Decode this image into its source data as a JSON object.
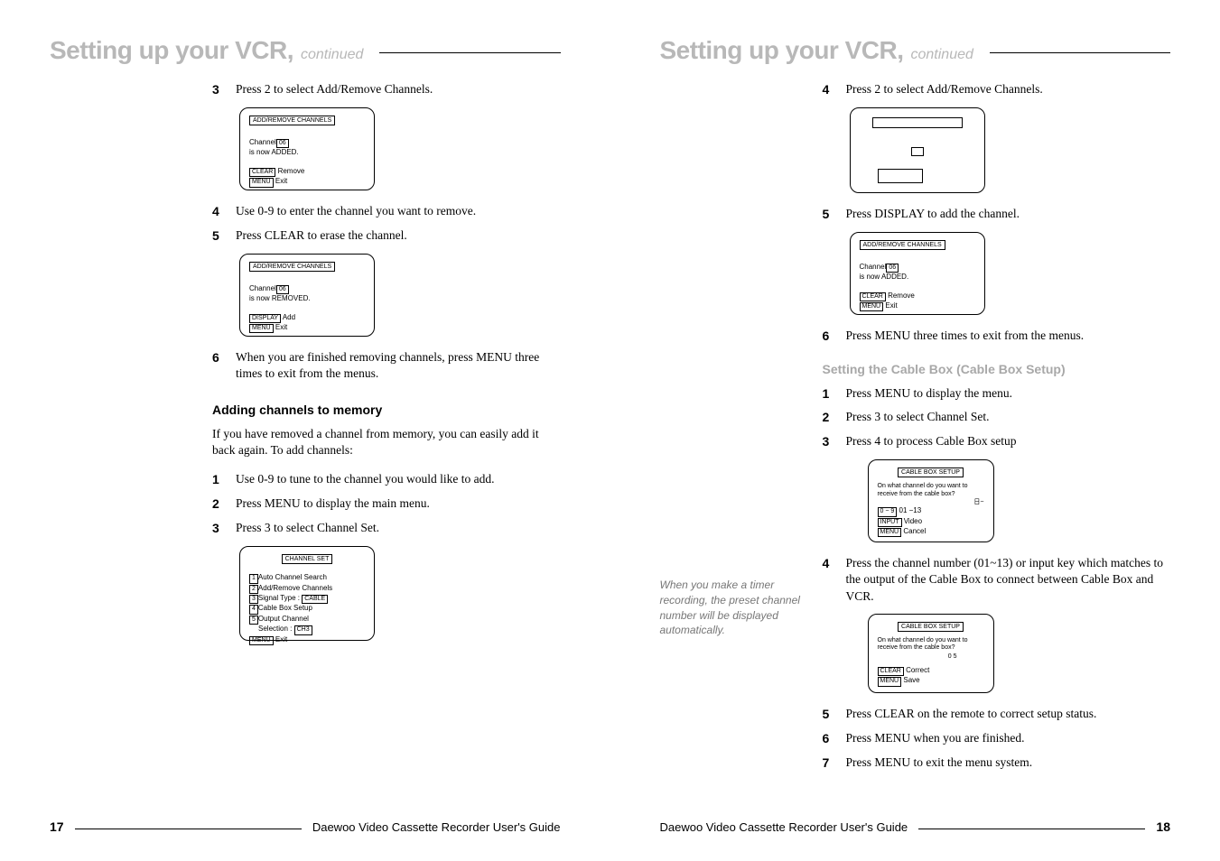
{
  "left": {
    "title": "Setting up your VCR,",
    "continued": "continued",
    "steps_a": [
      {
        "n": "3",
        "t": "Press 2 to select Add/Remove Channels."
      }
    ],
    "screen1": {
      "title": "ADD/REMOVE CHANNELS",
      "l1a": "Channel",
      "l1b": "06",
      "l2": "is now ADDED.",
      "b1": "CLEAR",
      "b1t": "Remove",
      "b2": "MENU",
      "b2t": "Exit"
    },
    "steps_b": [
      {
        "n": "4",
        "t": "Use 0-9 to enter the channel you want to remove."
      },
      {
        "n": "5",
        "t": "Press CLEAR to erase the channel."
      }
    ],
    "screen2": {
      "title": "ADD/REMOVE CHANNELS",
      "l1a": "Channel",
      "l1b": "06",
      "l2": "is now REMOVED.",
      "b1": "DISPLAY",
      "b1t": "Add",
      "b2": "MENU",
      "b2t": "Exit"
    },
    "steps_c": [
      {
        "n": "6",
        "t": "When you are finished removing channels, press MENU three times to exit from the menus."
      }
    ],
    "subhead": "Adding channels to memory",
    "para": "If you have removed a channel from memory, you can easily add it back again. To add channels:",
    "steps_d": [
      {
        "n": "1",
        "t": "Use 0-9 to tune to the channel you would like to add."
      },
      {
        "n": "2",
        "t": "Press MENU to display the main menu."
      },
      {
        "n": "3",
        "t": "Press 3 to select Channel Set."
      }
    ],
    "screen3": {
      "title": "CHANNEL SET",
      "rows": [
        {
          "k": "1",
          "t": "Auto Channel Search"
        },
        {
          "k": "2",
          "t": "Add/Remove Channels"
        },
        {
          "k": "3",
          "t": "Signal Type :",
          "tag": "CABLE"
        },
        {
          "k": "4",
          "t": "Cable Box Setup"
        },
        {
          "k": "5",
          "t": "Output Channel"
        }
      ],
      "sel": "Selection :",
      "seltag": "CH3",
      "b1": "MENU",
      "b1t": "Exit"
    },
    "footer_text": "Daewoo Video Cassette Recorder User's Guide",
    "page_num": "17"
  },
  "right": {
    "title": "Setting up your VCR,",
    "continued": "continued",
    "steps_a": [
      {
        "n": "4",
        "t": "Press 2 to select Add/Remove Channels."
      }
    ],
    "steps_b": [
      {
        "n": "5",
        "t": "Press DISPLAY to add the channel."
      }
    ],
    "screen1": {
      "title": "ADD/REMOVE CHANNELS",
      "l1a": "Channel",
      "l1b": "06",
      "l2": "is now ADDED.",
      "b1": "CLEAR",
      "b1t": "Remove",
      "b2": "MENU",
      "b2t": "Exit"
    },
    "steps_c": [
      {
        "n": "6",
        "t": "Press MENU three times to exit from the menus."
      }
    ],
    "subhead": "Setting the Cable Box (Cable Box Setup)",
    "steps_d": [
      {
        "n": "1",
        "t": "Press MENU to display the menu."
      },
      {
        "n": "2",
        "t": "Press 3 to select Channel Set."
      },
      {
        "n": "3",
        "t": "Press 4 to process Cable Box setup"
      }
    ],
    "screen2": {
      "title": "CABLE BOX SETUP",
      "l1": "On what channel do you want to receive from the cable box?",
      "dash": "日−",
      "r1k": "0 − 9",
      "r1v": "01 −13",
      "r2k": "INPUT",
      "r2v": "Video",
      "r3k": "MENU",
      "r3v": "Cancel"
    },
    "sidenote": "When you make a timer recording, the preset channel number will be displayed automatically.",
    "steps_e": [
      {
        "n": "4",
        "t": "Press the channel number (01~13) or input key which matches to the output of the Cable Box to connect between Cable Box and VCR."
      }
    ],
    "screen3": {
      "title": "CABLE BOX SETUP",
      "l1": "On what channel do you want to receive from the cable box?",
      "val": "0 5",
      "r1k": "CLEAR",
      "r1v": "Correct",
      "r2k": "MENU",
      "r2v": "Save"
    },
    "steps_f": [
      {
        "n": "5",
        "t": "Press CLEAR on the remote to correct setup status."
      },
      {
        "n": "6",
        "t": "Press MENU when you are finished."
      },
      {
        "n": "7",
        "t": "Press MENU to exit the menu system."
      }
    ],
    "footer_text": "Daewoo Video Cassette Recorder User's Guide",
    "page_num": "18"
  }
}
